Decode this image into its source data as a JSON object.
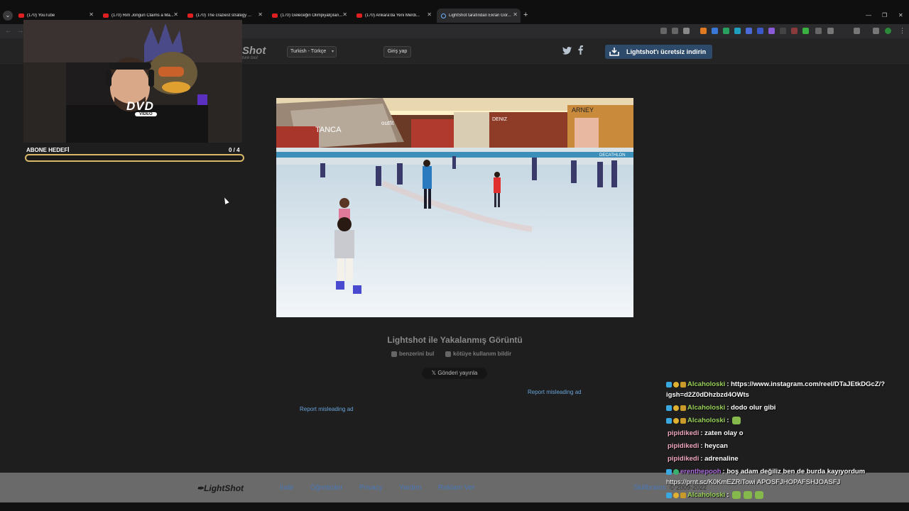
{
  "tabs": [
    {
      "title": "(170) YouTube",
      "favicon": "youtube-icon",
      "active": false
    },
    {
      "title": "(170) Rim Jongun Claims a Ma...",
      "favicon": "youtube-icon",
      "active": false
    },
    {
      "title": "(170) The craziest strategy ...",
      "favicon": "youtube-icon",
      "active": false
    },
    {
      "title": "(170) Geleceğin Olimpiyatçıları...",
      "favicon": "youtube-icon",
      "active": false
    },
    {
      "title": "(170) Ankara'da Yeni Merdi...",
      "favicon": "youtube-icon",
      "active": false
    },
    {
      "title": "LightShot tarafından Ekran Gör...",
      "favicon": "lightshot-icon",
      "active": true
    }
  ],
  "header": {
    "logo": "Shot",
    "logo_sub": "ture tool",
    "language": "Turkish - Türkçe",
    "login": "Giriş yap",
    "download": "Lightshot'ı ücretsiz indirin"
  },
  "screenshot": {
    "caption": "Lightshot ile Yakalanmış Görüntü",
    "find_similar": "benzerini bul",
    "report_abuse": "kötüye kullanım bildir",
    "post": "Gönderi yayınla",
    "store_signs": [
      "TANCA",
      "outfit",
      "DENIZ",
      "ARNEY",
      "DECATHLON"
    ]
  },
  "ads": {
    "report_right": "Report misleading ad",
    "report_left": "Report misleading ad"
  },
  "footer": {
    "logo": "LightShot",
    "links": [
      "İndir",
      "Öğreticiler",
      "Privacy",
      "Yardım",
      "Reklam Ver"
    ],
    "skillbrains": "Skillbrains",
    "copyright": "© 2009-2022"
  },
  "overlay": {
    "dvd": "DVD",
    "dvd_sub": "VIDEO",
    "goal_label": "ABONE HEDEFİ",
    "goal_count": "0  / 4",
    "goal_progress": 0.0
  },
  "chat": [
    {
      "user": "Alcaholoski",
      "user_color": "#9ad25a",
      "message": ": https://www.instagram.com/reel/DTaJEtkDGcZ/?",
      "continuation": "igsh=d2Z0dDhzbzd4OWts"
    },
    {
      "user": "Alcaholoski",
      "user_color": "#9ad25a",
      "message": ": dodo olur gibi"
    },
    {
      "user": "Alcaholoski",
      "user_color": "#9ad25a",
      "message": " :",
      "emotes": 1
    },
    {
      "user": "pipidikedi",
      "user_color": "#f0a8c0",
      "message": ": zaten olay o"
    },
    {
      "user": "pipidikedi",
      "user_color": "#f0a8c0",
      "message": ": heycan"
    },
    {
      "user": "pipidikedi",
      "user_color": "#f0a8c0",
      "message": ": adrenaline"
    },
    {
      "user": "erenthepooh",
      "user_color": "#b070e0",
      "message": ": boş adam değiliz ben de burda kayıyordum"
    },
    {
      "stray": "https://prnt.sc/K0KmEZRiTowi APOSFJHOPAFSHJOASFJ"
    },
    {
      "user": "Alcaholoski",
      "user_color": "#9ad25a",
      "message": " :",
      "emotes": 3
    }
  ]
}
